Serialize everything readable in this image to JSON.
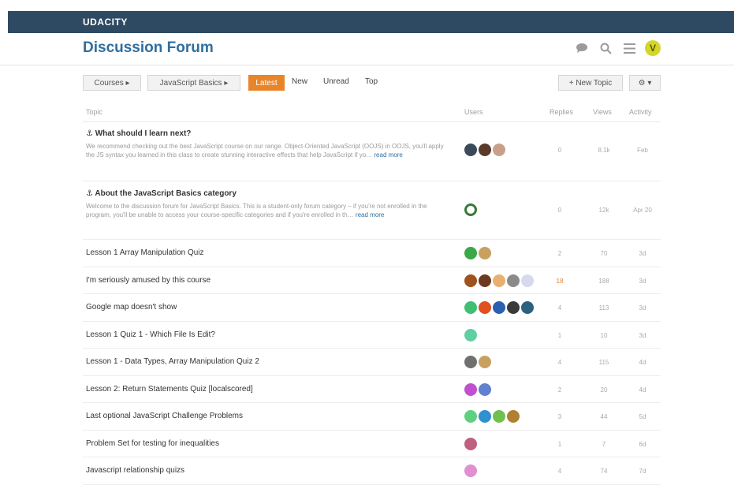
{
  "brand": "UDACITY",
  "header": {
    "title": "Discussion Forum",
    "avatar_letter": "V"
  },
  "toolbar": {
    "courses": "Courses ▸",
    "category": "JavaScript Basics ▸",
    "latest": "Latest",
    "new": "New",
    "unread": "Unread",
    "top": "Top",
    "new_topic": "+ New Topic",
    "settings": "⚙ ▾"
  },
  "columns": {
    "topic": "Topic",
    "users": "Users",
    "replies": "Replies",
    "views": "Views",
    "activity": "Activity"
  },
  "topics": [
    {
      "title": "⚓ What should I learn next?",
      "excerpt": "We recommend checking out the best JavaScript course on our range. Object-Oriented JavaScript (OOJS) in OOJS, you'll apply the JS syntax you learned in this class to create stunning interactive effects that help JavaScript if yo…",
      "read_more": "read more",
      "users": [
        "#3b4a5a",
        "#5a3a2a",
        "#c8a08a"
      ],
      "replies": "0",
      "views": "8.1k",
      "activity": "Feb"
    },
    {
      "title": "⚓ About the JavaScript Basics category",
      "excerpt": "Welcome to the discussion forum for JavaScript Basics. This is a student-only forum category – if you're not enrolled in the program, you'll be unable to access your course-specific categories and if you're enrolled in th…",
      "read_more": "read more",
      "users": [
        "#ffffff"
      ],
      "replies": "0",
      "views": "12k",
      "activity": "Apr 20"
    },
    {
      "title": "Lesson 1 Array Manipulation Quiz",
      "excerpt": "",
      "read_more": "",
      "users": [
        "#3aa845",
        "#c9a060"
      ],
      "replies": "2",
      "views": "70",
      "activity": "3d"
    },
    {
      "title": "I'm seriously amused by this course",
      "excerpt": "",
      "read_more": "",
      "users": [
        "#a0521c",
        "#6b3a20",
        "#e8b070",
        "#8a8a8a",
        "#d8d8f0"
      ],
      "replies": "18",
      "views": "188",
      "activity": "3d"
    },
    {
      "title": "Google map doesn't show",
      "excerpt": "",
      "read_more": "",
      "users": [
        "#3ec070",
        "#e05020",
        "#2b5fb0",
        "#3a3a3a",
        "#2a6080"
      ],
      "replies": "4",
      "views": "113",
      "activity": "3d"
    },
    {
      "title": "Lesson 1 Quiz 1 - Which File Is Edit?",
      "excerpt": "",
      "read_more": "",
      "users": [
        "#5fd0a0"
      ],
      "replies": "1",
      "views": "10",
      "activity": "3d"
    },
    {
      "title": "Lesson 1 - Data Types, Array Manipulation Quiz 2",
      "excerpt": "",
      "read_more": "",
      "users": [
        "#707070",
        "#c9a060"
      ],
      "replies": "4",
      "views": "115",
      "activity": "4d"
    },
    {
      "title": "Lesson 2: Return Statements Quiz [localscored]",
      "excerpt": "",
      "read_more": "",
      "users": [
        "#c050d0",
        "#6080d0"
      ],
      "replies": "2",
      "views": "20",
      "activity": "4d"
    },
    {
      "title": "Last optional JavaScript Challenge Problems",
      "excerpt": "",
      "read_more": "",
      "users": [
        "#60d080",
        "#3090d0",
        "#70c050",
        "#b08030"
      ],
      "replies": "3",
      "views": "44",
      "activity": "5d"
    },
    {
      "title": "Problem Set for testing for inequalities",
      "excerpt": "",
      "read_more": "",
      "users": [
        "#c06080"
      ],
      "replies": "1",
      "views": "7",
      "activity": "6d"
    },
    {
      "title": "Javascript relationship quizs",
      "excerpt": "",
      "read_more": "",
      "users": [
        "#e090d0"
      ],
      "replies": "4",
      "views": "74",
      "activity": "7d"
    }
  ]
}
